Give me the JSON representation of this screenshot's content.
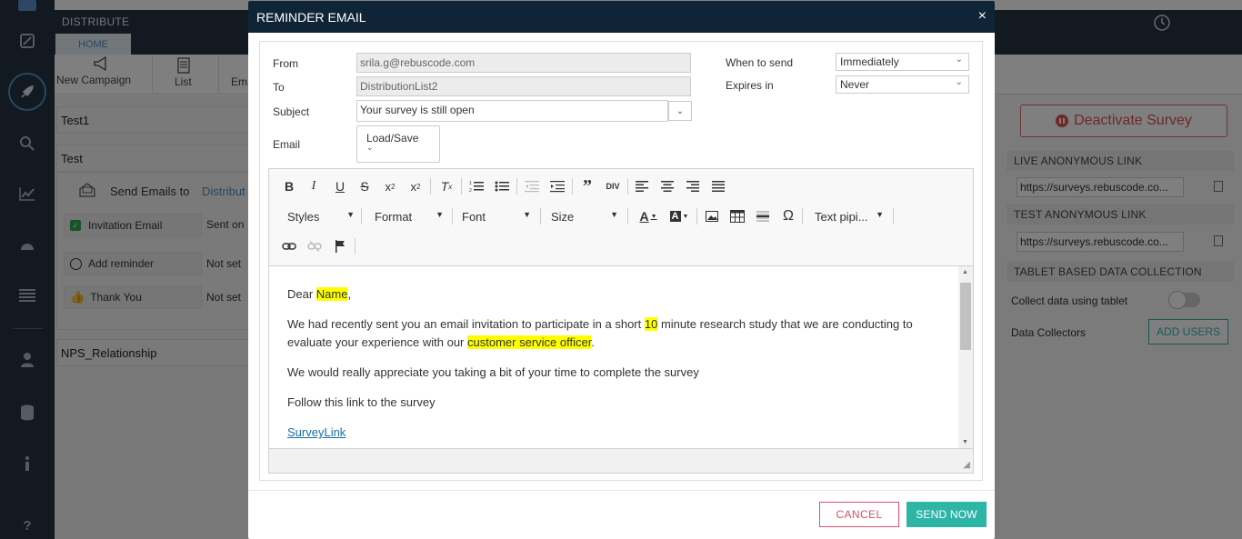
{
  "background": {
    "header": {
      "title": "DISTRIBUTE",
      "home_tab": "HOME"
    },
    "toolbar": {
      "new_campaign": "New Campaign",
      "list": "List",
      "em": "Em"
    },
    "campaigns": [
      "Test1",
      "Test",
      "NPS_Relationship"
    ],
    "test_items": {
      "send_emails_to": "Send Emails to",
      "distribution": "Distribut",
      "invitation_email": "Invitation Email",
      "invitation_status": "Sent on",
      "add_reminder": "Add reminder",
      "reminder_status": "Not set",
      "thank_you": "Thank You",
      "thank_you_status": "Not set"
    },
    "right_panel": {
      "deactivate": "Deactivate Survey",
      "live_link_title": "LIVE ANONYMOUS LINK",
      "live_link": "https://surveys.rebuscode.co...",
      "test_link_title": "TEST ANONYMOUS LINK",
      "test_link": "https://surveys.rebuscode.co...",
      "tablet_title": "TABLET BASED DATA COLLECTION",
      "collect_label": "Collect data using tablet",
      "data_collectors": "Data Collectors",
      "add_users": "ADD USERS"
    }
  },
  "modal": {
    "title": "REMINDER EMAIL",
    "close": "×",
    "from_label": "From",
    "from_value": "srila.g@rebuscode.com",
    "to_label": "To",
    "to_value": "DistributionList2",
    "subject_label": "Subject",
    "subject_value": "Your survey is still open",
    "email_label": "Email",
    "load_save": "Load/Save",
    "when_label": "When to send",
    "when_value": "Immediately",
    "expires_label": "Expires in",
    "expires_value": "Never",
    "editor": {
      "styles": "Styles",
      "format": "Format",
      "font": "Font",
      "size": "Size",
      "text_piping": "Text pipi...",
      "body": {
        "dear": "Dear ",
        "name": "Name",
        "dear_end": ",",
        "p2_a": "We had recently sent you an email invitation to participate in a short ",
        "p2_num": "10",
        "p2_b": " minute research study that we are conducting to evaluate your experience with our ",
        "p2_hl": "customer service officer",
        "p2_end": ".",
        "p3": "We would really appreciate you taking a bit of your time to complete the survey",
        "p4": "Follow this link to the survey",
        "link": "SurveyLink"
      }
    },
    "cancel": "CANCEL",
    "send_now": "SEND NOW"
  },
  "colors": {
    "nav_bg": "#243241",
    "modal_header": "#0f2436",
    "accent_teal": "#2db5a6",
    "cancel_red": "#d94f6e",
    "highlight": "#ffff00"
  }
}
